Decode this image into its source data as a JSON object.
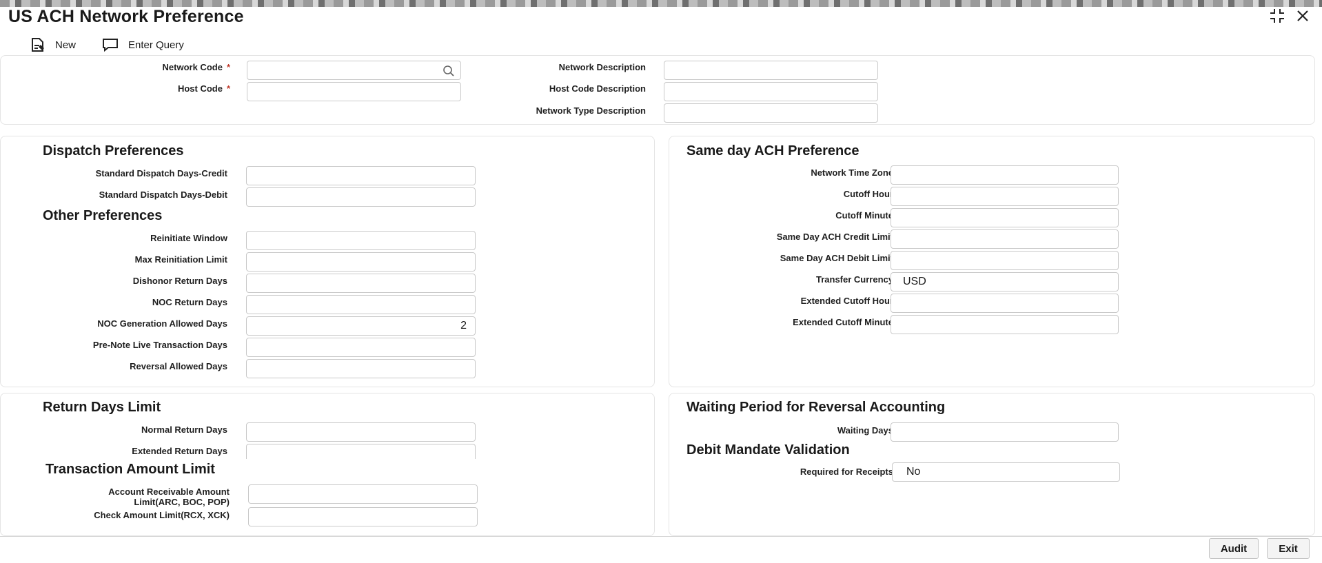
{
  "window": {
    "title": "US ACH Network Preference"
  },
  "toolbar": {
    "new_label": "New",
    "enter_query_label": "Enter Query"
  },
  "header": {
    "network_code_label": "Network Code",
    "host_code_label": "Host Code",
    "network_description_label": "Network Description",
    "host_code_description_label": "Host Code Description",
    "network_type_description_label": "Network Type Description",
    "required_marker": "*"
  },
  "dispatch": {
    "heading": "Dispatch Preferences",
    "std_credit_label": "Standard Dispatch Days-Credit",
    "std_debit_label": "Standard Dispatch Days-Debit"
  },
  "other": {
    "heading": "Other Preferences",
    "reinitiate_window_label": "Reinitiate Window",
    "max_reinitiation_label": "Max Reinitiation Limit",
    "dishonor_return_label": "Dishonor Return Days",
    "noc_return_label": "NOC Return Days",
    "noc_generation_label": "NOC Generation Allowed Days",
    "noc_generation_value": "2",
    "prenote_live_label": "Pre-Note Live Transaction Days",
    "reversal_allowed_label": "Reversal Allowed Days"
  },
  "same_day": {
    "heading": "Same day ACH Preference",
    "network_time_zone_label": "Network Time Zone",
    "cutoff_hour_label": "Cutoff Hour",
    "cutoff_minute_label": "Cutoff Minute",
    "credit_limit_label": "Same Day ACH Credit Limit",
    "debit_limit_label": "Same Day ACH Debit Limit",
    "transfer_currency_label": "Transfer Currency",
    "transfer_currency_value": "USD",
    "ext_cutoff_hour_label": "Extended Cutoff Hour",
    "ext_cutoff_minute_label": "Extended Cutoff Minute"
  },
  "return_days": {
    "heading": "Return Days Limit",
    "normal_label": "Normal Return Days",
    "extended_label": "Extended Return Days"
  },
  "txn_amount": {
    "heading": "Transaction Amount Limit",
    "arc_label_line1": "Account Receivable Amount",
    "arc_label_line2": "Limit(ARC, BOC, POP)",
    "check_label": "Check Amount Limit(RCX, XCK)"
  },
  "waiting": {
    "heading": "Waiting Period for Reversal Accounting",
    "waiting_days_label": "Waiting Days"
  },
  "mandate": {
    "heading": "Debit Mandate Validation",
    "required_receipts_label": "Required for Receipts",
    "required_receipts_value": "No"
  },
  "footer": {
    "audit_label": "Audit",
    "exit_label": "Exit"
  },
  "icons": {
    "new": "new-document-icon",
    "enter_query": "query-comment-icon",
    "search": "search-icon",
    "restore": "restore-window-icon",
    "close": "close-icon"
  }
}
